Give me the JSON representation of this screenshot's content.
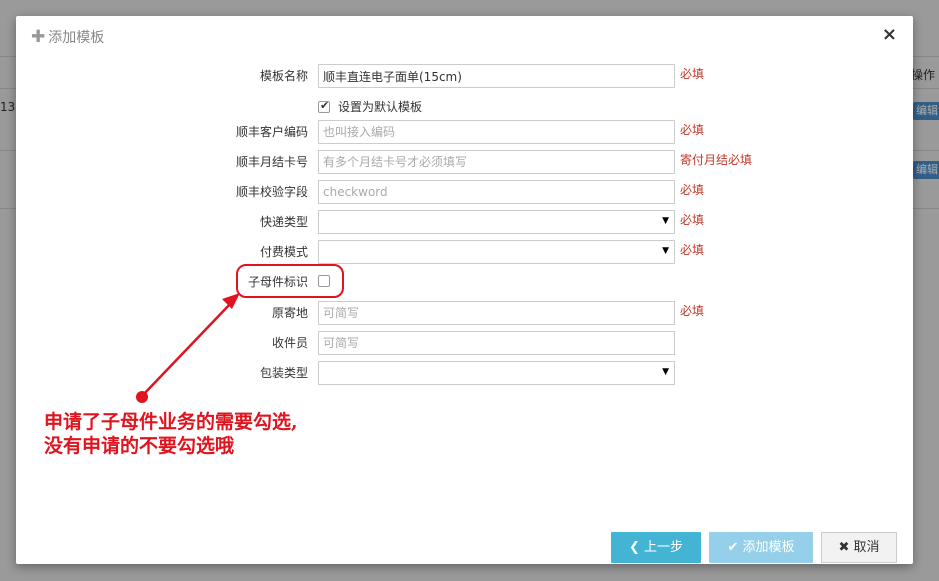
{
  "background": {
    "column_header": "操作",
    "row_fragment": "13",
    "edit_label": "编辑"
  },
  "modal": {
    "title": "添加模板",
    "form": {
      "template_name": {
        "label": "模板名称",
        "value": "顺丰直连电子面单(15cm)",
        "required": "必填"
      },
      "default_template": {
        "label": "设置为默认模板",
        "checked": true
      },
      "customer_code": {
        "label": "顺丰客户编码",
        "placeholder": "也叫接入编码",
        "required": "必填"
      },
      "monthly_card": {
        "label": "顺丰月结卡号",
        "placeholder": "有多个月结卡号才必须填写",
        "required": "寄付月结必填"
      },
      "checkword": {
        "label": "顺丰校验字段",
        "placeholder": "checkword",
        "required": "必填"
      },
      "express_type": {
        "label": "快递类型",
        "value": "",
        "required": "必填"
      },
      "payment_mode": {
        "label": "付费模式",
        "value": "",
        "required": "必填"
      },
      "parent_child": {
        "label": "子母件标识",
        "checked": false
      },
      "origin": {
        "label": "原寄地",
        "placeholder": "可简写",
        "required": "必填"
      },
      "courier": {
        "label": "收件员",
        "placeholder": "可简写"
      },
      "package_type": {
        "label": "包装类型",
        "value": ""
      }
    },
    "buttons": {
      "prev": "上一步",
      "add": "添加模板",
      "cancel": "取消"
    }
  },
  "annotation": {
    "line1": "申请了子母件业务的需要勾选,",
    "line2": "没有申请的不要勾选哦",
    "color": "#e0141e"
  }
}
